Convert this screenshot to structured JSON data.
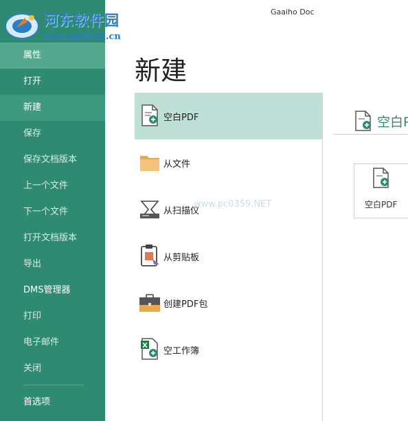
{
  "window": {
    "title": "Gaaiho Doc"
  },
  "watermark": {
    "title": "河东软件园",
    "url": "www.pc0359.cn",
    "faint": "www.pc0359.NET"
  },
  "sidebar": {
    "items": [
      {
        "label": "属性",
        "state": "highlight"
      },
      {
        "label": "打开",
        "state": "bright"
      },
      {
        "label": "新建",
        "state": "active"
      },
      {
        "label": "保存",
        "state": "normal"
      },
      {
        "label": "保存文档版本",
        "state": "normal"
      },
      {
        "label": "上一个文件",
        "state": "normal"
      },
      {
        "label": "下一个文件",
        "state": "normal"
      },
      {
        "label": "打开文档版本",
        "state": "normal"
      },
      {
        "label": "导出",
        "state": "normal"
      },
      {
        "label": "DMS管理器",
        "state": "bright"
      },
      {
        "label": "打印",
        "state": "normal"
      },
      {
        "label": "电子邮件",
        "state": "normal"
      },
      {
        "label": "关闭",
        "state": "normal"
      }
    ],
    "footer_item": {
      "label": "首选项"
    }
  },
  "main": {
    "heading": "新建",
    "options": [
      {
        "label": "空白PDF",
        "icon": "blank-pdf-icon",
        "selected": true
      },
      {
        "label": "从文件",
        "icon": "folder-icon",
        "selected": false
      },
      {
        "label": "从扫描仪",
        "icon": "scanner-icon",
        "selected": false
      },
      {
        "label": "从剪贴板",
        "icon": "clipboard-icon",
        "selected": false
      },
      {
        "label": "创建PDF包",
        "icon": "briefcase-icon",
        "selected": false
      },
      {
        "label": "空工作簿",
        "icon": "excel-workbook-icon",
        "selected": false
      }
    ]
  },
  "detail": {
    "header": "空白PDF",
    "card_label": "空白PDF"
  },
  "colors": {
    "sidebar": "#2e8a71",
    "selected_option": "#bfe0d6",
    "accent": "#2e8a71"
  }
}
